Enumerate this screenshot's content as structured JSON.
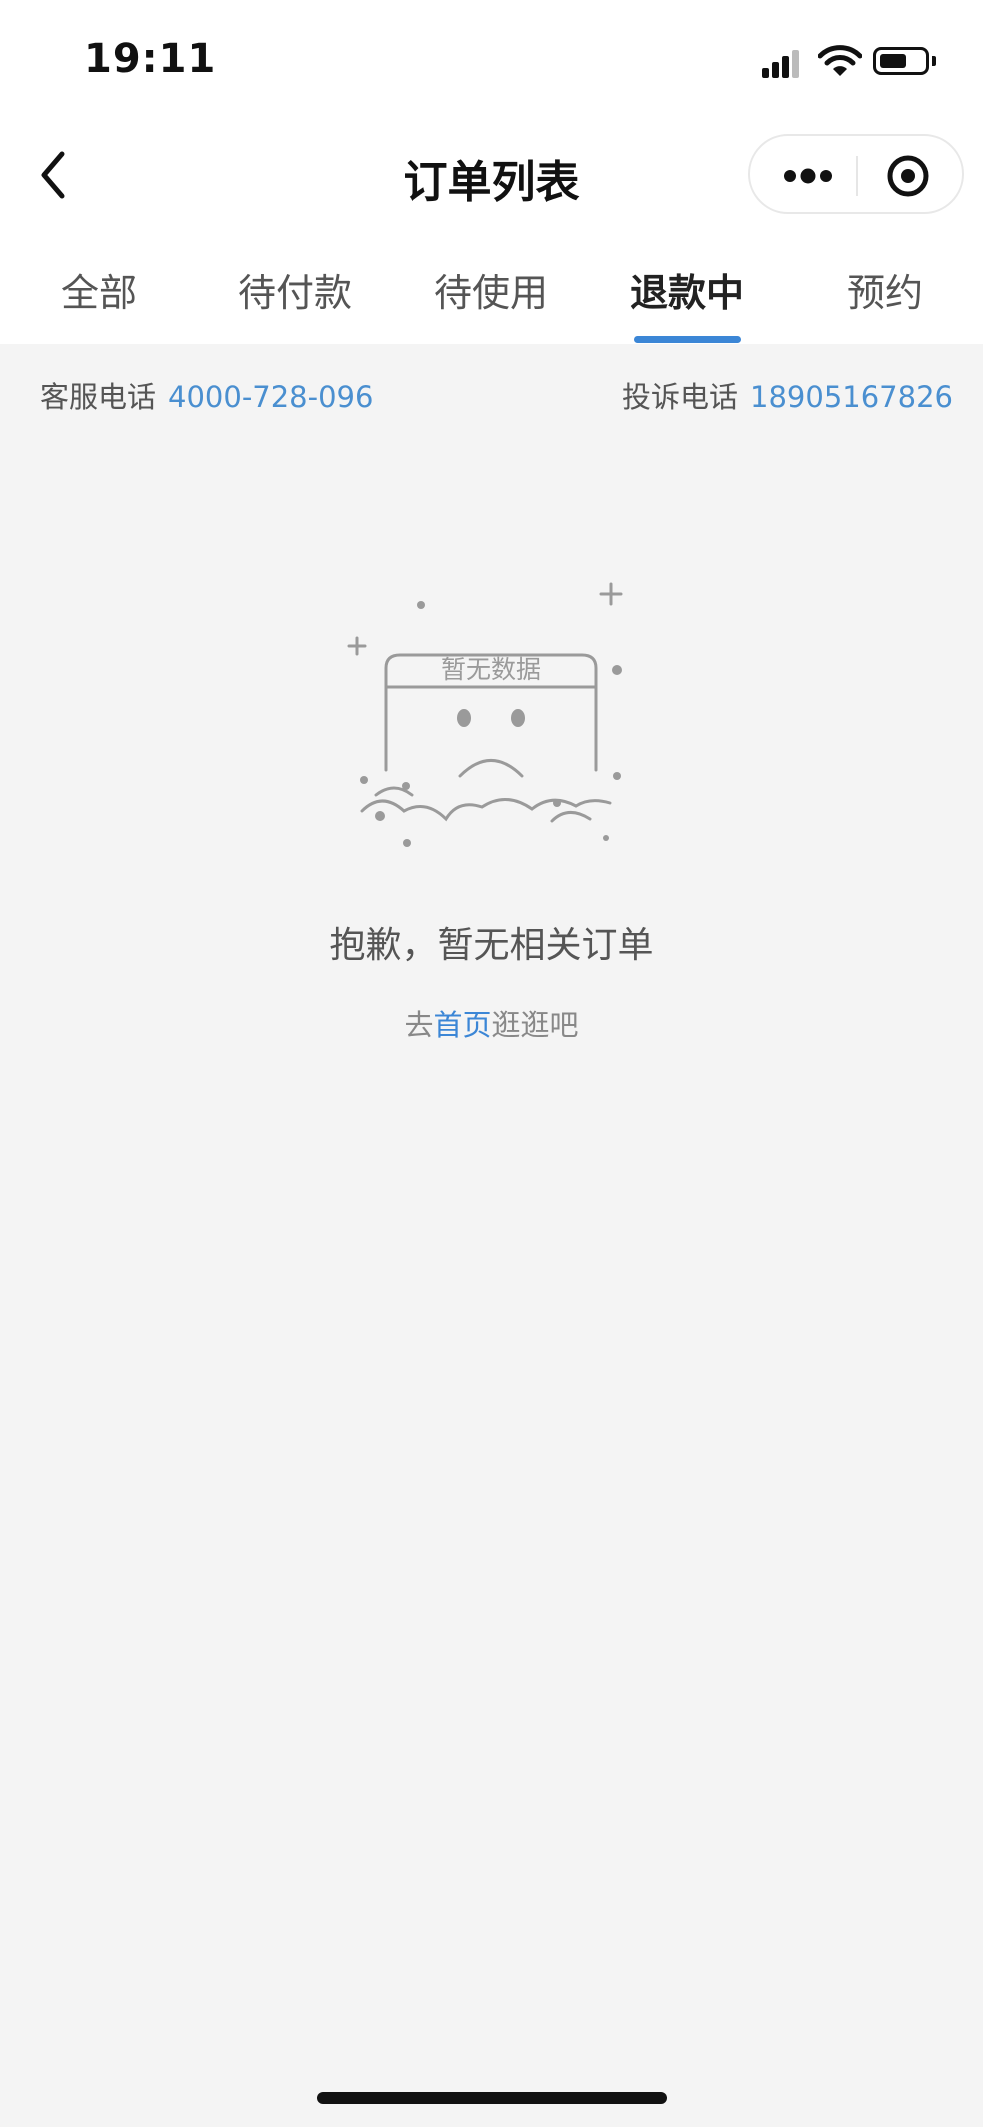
{
  "status_bar": {
    "time": "19:11"
  },
  "nav": {
    "title": "订单列表"
  },
  "tabs": [
    {
      "label": "全部"
    },
    {
      "label": "待付款"
    },
    {
      "label": "待使用"
    },
    {
      "label": "退款中",
      "active": true
    },
    {
      "label": "预约"
    }
  ],
  "contact": {
    "service_label": "客服电话",
    "service_phone": "4000-728-096",
    "complaint_label": "投诉电话",
    "complaint_phone": "18905167826"
  },
  "empty": {
    "illustration_text": "暂无数据",
    "title": "抱歉，暂无相关订单",
    "hint_prefix": "去",
    "hint_link": "首页",
    "hint_suffix": "逛逛吧"
  },
  "colors": {
    "accent": "#3b86d6",
    "background": "#f4f4f4",
    "phone_link": "#4a8fd0"
  }
}
